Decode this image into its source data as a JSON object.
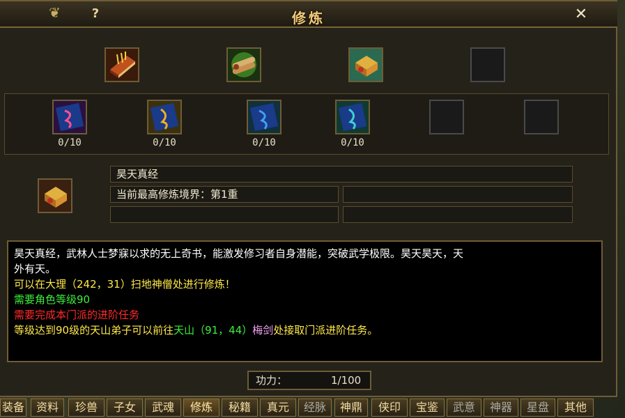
{
  "window": {
    "title": "修炼",
    "help_label": "?",
    "close_label": "✕"
  },
  "top_slots": [
    {
      "name": "red-book-item",
      "filled": true
    },
    {
      "name": "scroll-bundle-item",
      "filled": true
    },
    {
      "name": "treasure-chest-item",
      "filled": true
    },
    {
      "name": "empty-slot",
      "filled": false
    }
  ],
  "skill_slots": [
    {
      "count": "0/10",
      "filled": true,
      "accent": "#c0305a"
    },
    {
      "count": "0/10",
      "filled": true,
      "accent": "#d09020"
    },
    {
      "count": "0/10",
      "filled": true,
      "accent": "#3080c0"
    },
    {
      "count": "0/10",
      "filled": true,
      "accent": "#30a0c0"
    },
    {
      "count": "",
      "filled": false
    },
    {
      "count": "",
      "filled": false
    }
  ],
  "detail": {
    "name": "昊天真经",
    "realm": "当前最高修炼境界：第1重"
  },
  "description": {
    "line1": "昊天真经，武林人士梦寐以求的无上奇书，能激发修习者自身潜能，突破武学极限。昊天昊天，天",
    "line2": "外有天。",
    "line3": "可以在大理（242，31）扫地神僧处进行修炼！",
    "line4": "需要角色等级90",
    "line5": "需要完成本门派的进阶任务",
    "line6_a": "等级达到90级的天山弟子可以前往",
    "line6_b": "天山（91，44）",
    "line6_c": "梅剑",
    "line6_d": "处接取门派进阶任务。",
    "colors": {
      "white": "#ffffff",
      "yellow": "#ffe94a",
      "green": "#3cf03c",
      "red": "#ff2a2a",
      "pink": "#f0a0f0"
    }
  },
  "power": {
    "label": "功力：",
    "value": "1/100"
  },
  "tabs": [
    {
      "label": "装备",
      "dim": false
    },
    {
      "label": "资料",
      "dim": false
    },
    {
      "label": "珍兽",
      "dim": false
    },
    {
      "label": "子女",
      "dim": false
    },
    {
      "label": "武魂",
      "dim": false
    },
    {
      "label": "修炼",
      "dim": false,
      "active": true
    },
    {
      "label": "秘籍",
      "dim": false
    },
    {
      "label": "真元",
      "dim": false
    },
    {
      "label": "经脉",
      "dim": true
    },
    {
      "label": "神鼎",
      "dim": false
    },
    {
      "label": "侠印",
      "dim": false
    },
    {
      "label": "宝鉴",
      "dim": false
    },
    {
      "label": "武意",
      "dim": true
    },
    {
      "label": "神器",
      "dim": true
    },
    {
      "label": "星盘",
      "dim": true
    },
    {
      "label": "其他",
      "dim": false
    }
  ]
}
